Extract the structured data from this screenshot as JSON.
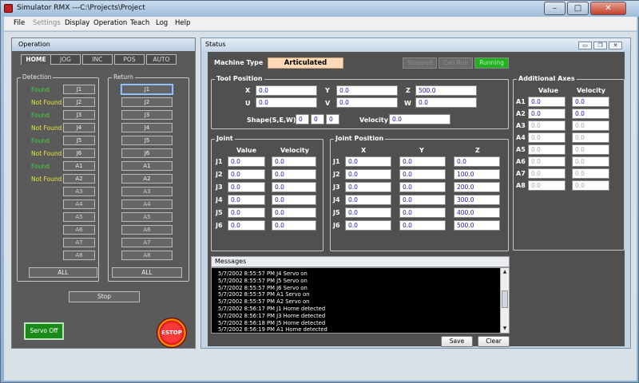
{
  "window": {
    "title": "Simulator RMX ---C:\\Projects\\Project",
    "min": "–",
    "max": "□",
    "close": "✕"
  },
  "menu": [
    "File",
    "Settings",
    "Display",
    "Operation",
    "Teach",
    "Log",
    "Help"
  ],
  "operation": {
    "title": "Operation",
    "tabs": [
      "HOME",
      "JOG",
      "INC",
      "POS",
      "AUTO"
    ],
    "detection_label": "Detection",
    "return_label": "Return",
    "detection": [
      {
        "status": "Found",
        "axis": "J1"
      },
      {
        "status": "Not Found",
        "axis": "J2"
      },
      {
        "status": "Found",
        "axis": "J3"
      },
      {
        "status": "Not Found",
        "axis": "J4"
      },
      {
        "status": "Found",
        "axis": "J5"
      },
      {
        "status": "Not Found",
        "axis": "J6"
      },
      {
        "status": "Found",
        "axis": "A1"
      },
      {
        "status": "Not Found",
        "axis": "A2"
      },
      {
        "status": "",
        "axis": "A3"
      },
      {
        "status": "",
        "axis": "A4"
      },
      {
        "status": "",
        "axis": "A5"
      },
      {
        "status": "",
        "axis": "A6"
      },
      {
        "status": "",
        "axis": "A7"
      },
      {
        "status": "",
        "axis": "A8"
      }
    ],
    "return_axes": [
      "J1",
      "J2",
      "J3",
      "J4",
      "J5",
      "J6",
      "A1",
      "A2",
      "A3",
      "A4",
      "A5",
      "A6",
      "A7",
      "A8"
    ],
    "all_label": "ALL",
    "stop_label": "Stop",
    "servo_label": "Servo Off",
    "estop_label": "ESTOP",
    "colors": {
      "found": "#3fd63f",
      "not_found": "#e8e83a"
    }
  },
  "status": {
    "title": "Status",
    "machine_type_label": "Machine Type",
    "machine_type": "Articulated",
    "indicators": [
      {
        "label": "Stopped",
        "active": false
      },
      {
        "label": "Can Run",
        "active": false
      },
      {
        "label": "Running",
        "active": true
      }
    ],
    "tool_position": {
      "label": "Tool Position",
      "X": "0.0",
      "Y": "0.0",
      "Z": "500.0",
      "U": "0.0",
      "V": "0.0",
      "W": "0.0",
      "shape_label": "Shape(S,E,W)",
      "shape": [
        "0",
        "0",
        "0"
      ],
      "velocity_label": "Velocity",
      "velocity": "0.0"
    },
    "joint": {
      "label": "Joint",
      "value_header": "Value",
      "velocity_header": "Velocity",
      "rows": [
        {
          "name": "J1",
          "value": "0.0",
          "velocity": "0.0"
        },
        {
          "name": "J2",
          "value": "0.0",
          "velocity": "0.0"
        },
        {
          "name": "J3",
          "value": "0.0",
          "velocity": "0.0"
        },
        {
          "name": "J4",
          "value": "0.0",
          "velocity": "0.0"
        },
        {
          "name": "J5",
          "value": "0.0",
          "velocity": "0.0"
        },
        {
          "name": "J6",
          "value": "0.0",
          "velocity": "0.0"
        }
      ]
    },
    "joint_position": {
      "label": "Joint Position",
      "headers": [
        "X",
        "Y",
        "Z"
      ],
      "rows": [
        {
          "name": "J1",
          "x": "0.0",
          "y": "0.0",
          "z": "0.0"
        },
        {
          "name": "J2",
          "x": "0.0",
          "y": "0.0",
          "z": "100.0"
        },
        {
          "name": "J3",
          "x": "0.0",
          "y": "0.0",
          "z": "200.0"
        },
        {
          "name": "J4",
          "x": "0.0",
          "y": "0.0",
          "z": "300.0"
        },
        {
          "name": "J5",
          "x": "0.0",
          "y": "0.0",
          "z": "400.0"
        },
        {
          "name": "J6",
          "x": "0.0",
          "y": "0.0",
          "z": "500.0"
        }
      ]
    },
    "additional_axes": {
      "label": "Additional Axes",
      "value_header": "Value",
      "velocity_header": "Velocity",
      "rows": [
        {
          "name": "A1",
          "value": "0.0",
          "velocity": "0.0",
          "active": true
        },
        {
          "name": "A2",
          "value": "0.0",
          "velocity": "0.0",
          "active": true
        },
        {
          "name": "A3",
          "value": "0.0",
          "velocity": "0.0",
          "active": false
        },
        {
          "name": "A4",
          "value": "0.0",
          "velocity": "0.0",
          "active": false
        },
        {
          "name": "A5",
          "value": "0.0",
          "velocity": "0.0",
          "active": false
        },
        {
          "name": "A6",
          "value": "0.0",
          "velocity": "0.0",
          "active": false
        },
        {
          "name": "A7",
          "value": "0.0",
          "velocity": "0.0",
          "active": false
        },
        {
          "name": "A8",
          "value": "0.0",
          "velocity": "0.0",
          "active": false
        }
      ]
    },
    "messages_label": "Messages",
    "messages": [
      "5/7/2002 8:55:57 PM J4 Servo on",
      "5/7/2002 8:55:57 PM J5 Servo on",
      "5/7/2002 8:55:57 PM J6 Servo on",
      "5/7/2002 8:55:57 PM A1 Servo on",
      "5/7/2002 8:55:57 PM A2 Servo on",
      "5/7/2002 8:56:17 PM J1 Home detected",
      "5/7/2002 8:56:17 PM J3 Home detected",
      "5/7/2002 8:56:18 PM J5 Home detected",
      "5/7/2002 8:56:19 PM A1 Home detected"
    ],
    "save_label": "Save",
    "clear_label": "Clear"
  }
}
